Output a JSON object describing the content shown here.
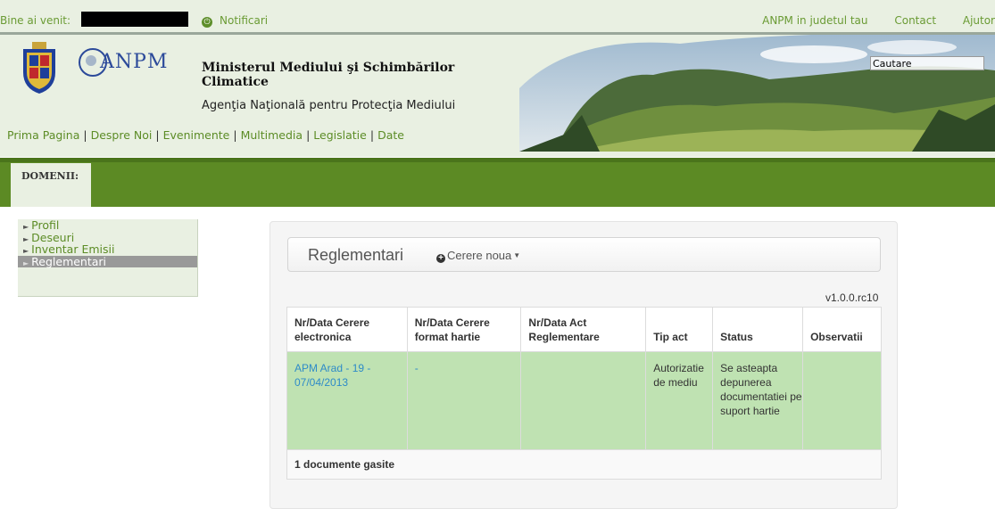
{
  "topbar": {
    "welcome": "Bine ai venit:",
    "notifications": "Notificari",
    "power_icon": "power-icon",
    "links": [
      "ANPM in judetul tau",
      "Contact",
      "Ajutor"
    ]
  },
  "header": {
    "logo_text": "ANPM",
    "ministry": "Ministerul Mediului şi Schimbărilor Climatice",
    "agency": "Agenţia Naţională pentru Protecţia Mediului",
    "nav": [
      "Prima Pagina",
      "Despre Noi",
      "Evenimente",
      "Multimedia",
      "Legislatie",
      "Date"
    ],
    "search_value": "Cautare"
  },
  "domains": {
    "label": "DOMENII:"
  },
  "sidebar": {
    "items": [
      {
        "label": "Profil",
        "active": false
      },
      {
        "label": "Deseuri",
        "active": false
      },
      {
        "label": "Inventar Emisii",
        "active": false
      },
      {
        "label": "Reglementari",
        "active": true
      }
    ]
  },
  "main": {
    "title": "Reglementari",
    "new_request": "Cerere noua",
    "version": "v1.0.0.rc10",
    "table": {
      "headers": [
        "Nr/Data Cerere electronica",
        "Nr/Data Cerere format hartie",
        "Nr/Data Act Reglementare",
        "Tip act",
        "Status",
        "Observatii"
      ],
      "rows": [
        {
          "electronic": "APM Arad - 19 - 07/04/2013",
          "paper": "-",
          "act": "",
          "type": "Autorizatie de mediu",
          "status": "Se asteapta depunerea documentatiei pe suport hartie",
          "notes": ""
        }
      ],
      "footer": "1 documente gasite"
    }
  },
  "colors": {
    "header_bg": "#e9f0e2",
    "domain_bar": "#5c8a24",
    "link_green": "#5c8c26",
    "link_blue": "#2e8bc8",
    "row_highlight": "#bfe2b2"
  }
}
